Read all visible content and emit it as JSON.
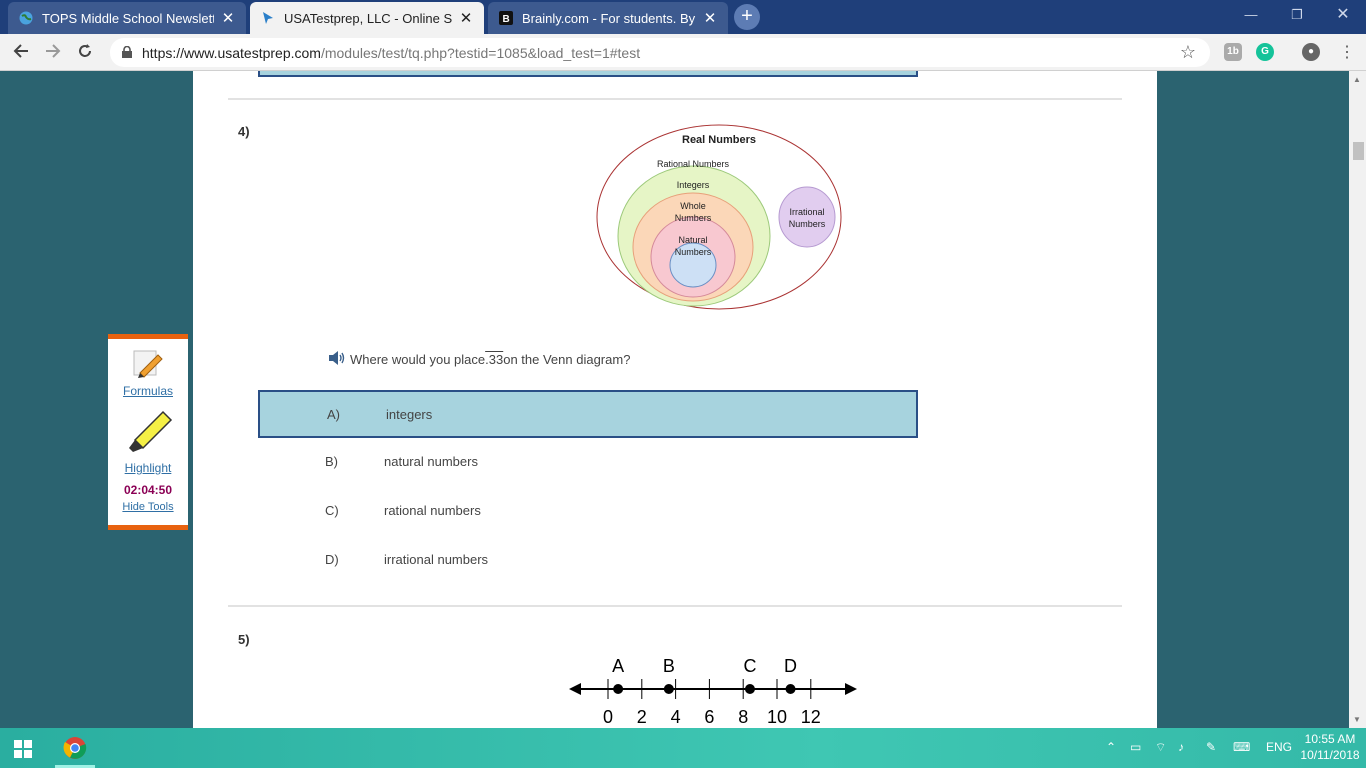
{
  "browser": {
    "tabs": [
      {
        "title": "TOPS Middle School Newsletter",
        "active": false
      },
      {
        "title": "USATestprep, LLC - Online State-S",
        "active": true
      },
      {
        "title": "Brainly.com - For students. By stu",
        "active": false
      }
    ],
    "url_host": "https://www.usatestprep.com",
    "url_path": "/modules/test/tq.php?testid=1085&load_test=1#test"
  },
  "tools": {
    "formulas": "Formulas",
    "highlight": "Highlight",
    "timer": "02:04:50",
    "hide": "Hide Tools"
  },
  "question4": {
    "number": "4)",
    "prompt_before": "Where would you place ",
    "prompt_value": ".33",
    "prompt_after": " on the Venn diagram?",
    "venn": {
      "outer": "Real Numbers",
      "rational": "Rational Numbers",
      "integers": "Integers",
      "whole_1": "Whole",
      "whole_2": "Numbers",
      "natural_1": "Natural",
      "natural_2": "Numbers",
      "irrational_1": "Irrational",
      "irrational_2": "Numbers"
    },
    "choices": [
      {
        "letter": "A)",
        "text": "integers",
        "selected": true
      },
      {
        "letter": "B)",
        "text": "natural numbers",
        "selected": false
      },
      {
        "letter": "C)",
        "text": "rational numbers",
        "selected": false
      },
      {
        "letter": "D)",
        "text": "irrational numbers",
        "selected": false
      }
    ]
  },
  "question5": {
    "number": "5)",
    "numberline": {
      "points": [
        {
          "label": "A",
          "value": 0.6
        },
        {
          "label": "B",
          "value": 3.6
        },
        {
          "label": "C",
          "value": 8.4
        },
        {
          "label": "D",
          "value": 10.8
        }
      ],
      "ticks": [
        "0",
        "2",
        "4",
        "6",
        "8",
        "10",
        "12"
      ]
    }
  },
  "taskbar": {
    "lang": "ENG",
    "time": "10:55 AM",
    "date": "10/11/2018"
  },
  "colors": {
    "page_bg": "#2b6370",
    "selected_choice": "#a7d3de",
    "tools_border": "#e8620f",
    "timer": "#8b0055"
  }
}
